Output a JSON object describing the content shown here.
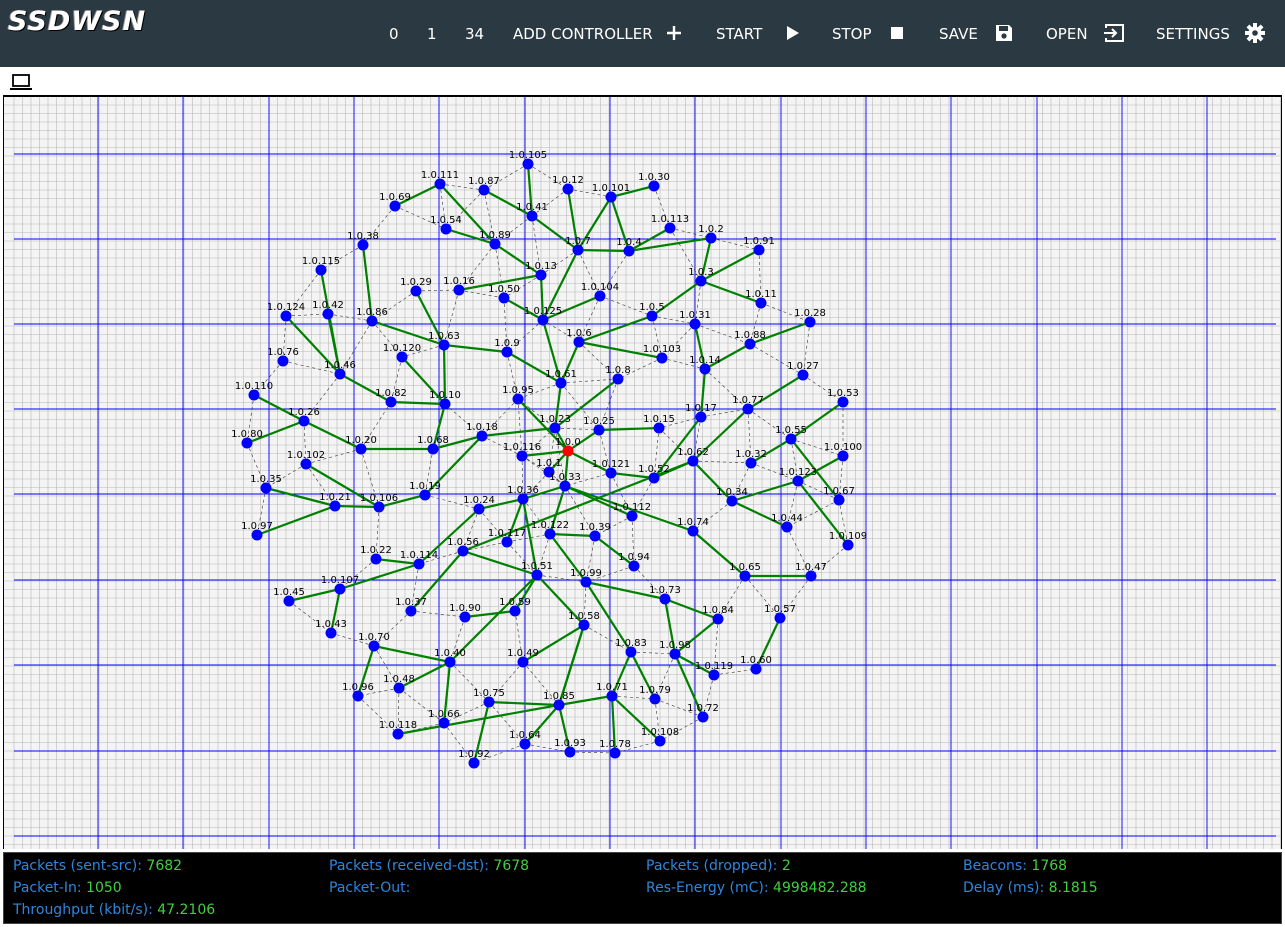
{
  "app": {
    "title": "SSDWSN"
  },
  "toolbar": {
    "items": [
      {
        "label": "0"
      },
      {
        "label": "1"
      },
      {
        "label": "34"
      },
      {
        "label": "ADD CONTROLLER",
        "icon": "plus-icon"
      },
      {
        "label": "START",
        "icon": "play-icon"
      },
      {
        "label": "STOP",
        "icon": "stop-icon"
      },
      {
        "label": "SAVE",
        "icon": "save-icon"
      },
      {
        "label": "OPEN",
        "icon": "login-icon"
      },
      {
        "label": "SETTINGS",
        "icon": "gear-icon"
      }
    ]
  },
  "tabs": [
    {
      "icon": "laptop-icon"
    }
  ],
  "network": {
    "sink": "1.0.0",
    "colors": {
      "node": "#0000ff",
      "sink": "#ff0000",
      "route": "#008000",
      "link": "#333333",
      "grid_minor": "#b8b8b8",
      "grid_major": "#0000ff"
    },
    "nodes": [
      "1.0.105",
      "1.0.12",
      "1.0.101",
      "1.0.30",
      "1.0.111",
      "1.0.87",
      "1.0.69",
      "1.0.41",
      "1.0.113",
      "1.0.54",
      "1.0.89",
      "1.0.7",
      "1.0.4",
      "1.0.2",
      "1.0.91",
      "1.0.38",
      "1.0.115",
      "1.0.13",
      "1.0.29",
      "1.0.16",
      "1.0.50",
      "1.0.104",
      "1.0.3",
      "1.0.11",
      "1.0.124",
      "1.0.42",
      "1.0.86",
      "1.0.125",
      "1.0.5",
      "1.0.31",
      "1.0.28",
      "1.0.63",
      "1.0.6",
      "1.0.88",
      "1.0.76",
      "1.0.120",
      "1.0.9",
      "1.0.103",
      "1.0.46",
      "1.0.14",
      "1.0.61",
      "1.0.8",
      "1.0.27",
      "1.0.110",
      "1.0.82",
      "1.0.10",
      "1.0.95",
      "1.0.53",
      "1.0.26",
      "1.0.17",
      "1.0.77",
      "1.0.18",
      "1.0.23",
      "1.0.25",
      "1.0.15",
      "1.0.80",
      "1.0.20",
      "1.0.68",
      "1.0.116",
      "1.0.0",
      "1.0.55",
      "1.0.100",
      "1.0.102",
      "1.0.1",
      "1.0.121",
      "1.0.62",
      "1.0.52",
      "1.0.32",
      "1.0.33",
      "1.0.123",
      "1.0.35",
      "1.0.19",
      "1.0.36",
      "1.0.67",
      "1.0.21",
      "1.0.106",
      "1.0.24",
      "1.0.34",
      "1.0.112",
      "1.0.44",
      "1.0.117",
      "1.0.122",
      "1.0.39",
      "1.0.74",
      "1.0.97",
      "1.0.109",
      "1.0.56",
      "1.0.22",
      "1.0.114",
      "1.0.94",
      "1.0.51",
      "1.0.99",
      "1.0.65",
      "1.0.47",
      "1.0.107",
      "1.0.73",
      "1.0.45",
      "1.0.37",
      "1.0.90",
      "1.0.59",
      "1.0.84",
      "1.0.57",
      "1.0.58",
      "1.0.43",
      "1.0.70",
      "1.0.40",
      "1.0.49",
      "1.0.83",
      "1.0.98",
      "1.0.119",
      "1.0.60",
      "1.0.48",
      "1.0.96",
      "1.0.75",
      "1.0.71",
      "1.0.79",
      "1.0.85",
      "1.0.66",
      "1.0.72",
      "1.0.118",
      "1.0.64",
      "1.0.108",
      "1.0.93",
      "1.0.78",
      "1.0.92"
    ]
  },
  "stats": {
    "packets_sent_src": {
      "label": "Packets (sent-src): ",
      "value": "7682"
    },
    "packets_received_dst": {
      "label": "Packets (received-dst): ",
      "value": "7678"
    },
    "packets_dropped": {
      "label": "Packets (dropped): ",
      "value": "2"
    },
    "beacons": {
      "label": "Beacons: ",
      "value": "1768"
    },
    "packet_in": {
      "label": "Packet-In: ",
      "value": "1050"
    },
    "packet_out": {
      "label": "Packet-Out: ",
      "value": ""
    },
    "res_energy": {
      "label": "Res-Energy (mC): ",
      "value": "4998482.288"
    },
    "delay": {
      "label": "Delay (ms): ",
      "value": "8.1815"
    },
    "throughput": {
      "label": "Throughput (kbit/s): ",
      "value": "47.2106"
    }
  }
}
